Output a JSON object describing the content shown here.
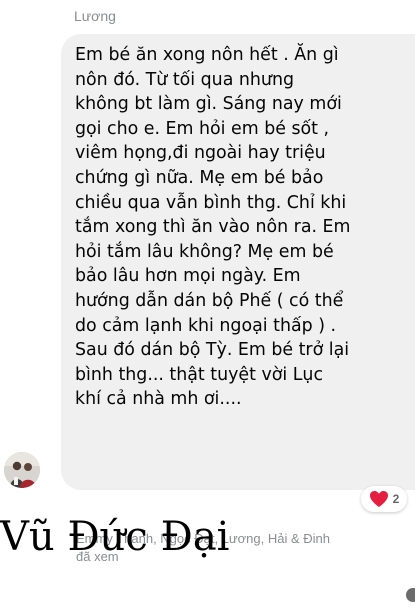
{
  "sender": {
    "name": "Lương"
  },
  "message": {
    "text": "Em bé ăn xong nôn hết . Ăn gì\nnôn đó. Từ tối qua nhưng\nkhông bt làm gì. Sáng nay mới\ngọi cho e. Em hỏi em bé sốt ,\nviêm họng,đi ngoài hay triệu\nchứng gì nữa. Mẹ em bé bảo\nchiều qua vẫn bình thg. Chỉ khi\ntắm xong thì ăn vào nôn ra. Em\nhỏi tắm lâu không? Mẹ em bé\nbảo lâu hơn mọi ngày. Em\nhướng dẫn dán bộ Phế ( có thể\ndo cảm lạnh khi ngoại thấp ) .\nSau đó dán bộ Tỳ. Em bé trở lại\nbình thg... thật tuyệt vời Lục\nkhí cả nhà mh ơi...."
  },
  "reaction": {
    "icon": "heart-icon",
    "count": "2",
    "color": "#e41e3f"
  },
  "seen": {
    "line1": "Emmy Thanh, Ngọc Đạt, Lương, Hải & Đinh",
    "line2": "đã xem"
  },
  "overlay": {
    "author_name": "Vũ Đức Đại"
  },
  "colors": {
    "bubble": "#f0f0f0",
    "meta_text": "#8a8d91"
  }
}
